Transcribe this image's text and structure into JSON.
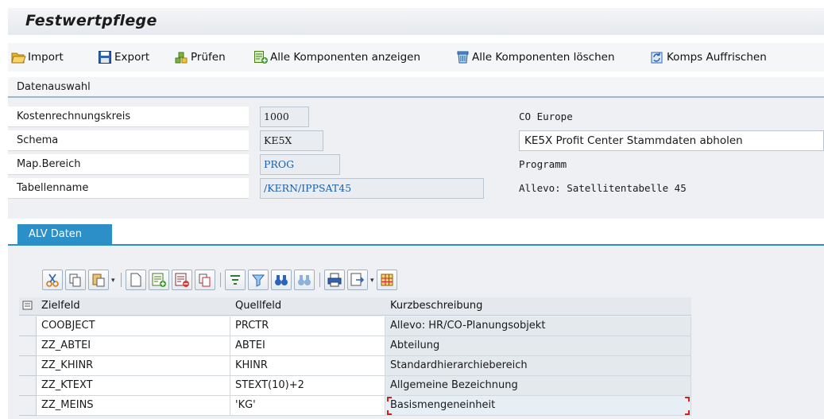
{
  "window": {
    "title": "Festwertpflege"
  },
  "toolbar": {
    "import_label": "Import",
    "export_label": "Export",
    "check_label": "Prüfen",
    "show_all_label": "Alle Komponenten anzeigen",
    "delete_all_label": "Alle Komponenten löschen",
    "refresh_label": "Komps Auffrischen"
  },
  "datenauswahl": {
    "heading": "Datenauswahl",
    "fields": [
      {
        "label": "Kostenrechnungskreis",
        "value": "1000",
        "description": "CO Europe"
      },
      {
        "label": "Schema",
        "value": "KE5X",
        "description": "KE5X Profit Center Stammdaten abholen"
      },
      {
        "label": "Map.Bereich",
        "value": "PROG",
        "description": "Programm"
      },
      {
        "label": "Tabellenname",
        "value": "/KERN/IPPSAT45",
        "description": "Allevo: Satellitentabelle 45"
      }
    ]
  },
  "tabs": [
    {
      "label": "ALV Daten"
    }
  ],
  "alv": {
    "columns": [
      "Zielfeld",
      "Quellfeld",
      "Kurzbeschreibung"
    ],
    "rows": [
      [
        "COOBJECT",
        "PRCTR",
        "Allevo: HR/CO-Planungsobjekt"
      ],
      [
        "ZZ_ABTEI",
        "ABTEI",
        "Abteilung"
      ],
      [
        "ZZ_KHINR",
        "KHINR",
        "Standardhierarchiebereich"
      ],
      [
        "ZZ_KTEXT",
        "STEXT(10)+2",
        "Allgemeine Bezeichnung"
      ],
      [
        "ZZ_MEINS",
        "'KG'",
        "Basismengeneinheit"
      ]
    ]
  },
  "colors": {
    "accent": "#2d8fc8",
    "focus_marker": "#d12020"
  }
}
